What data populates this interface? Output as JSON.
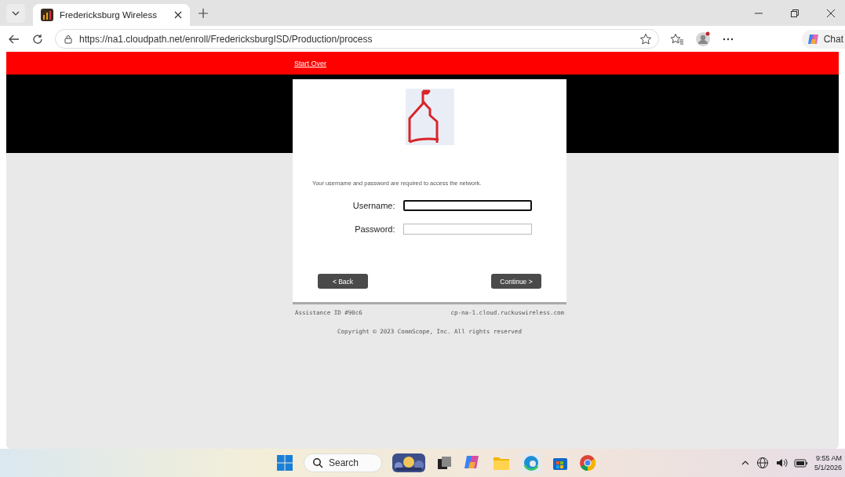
{
  "browser": {
    "tab_title": "Fredericksburg Wireless",
    "url": "https://na1.cloudpath.net/enroll/FredericksburgISD/Production/process",
    "copilot_label": "Chat"
  },
  "page": {
    "start_over": "Start Over",
    "message": "Your username and password are required to access the network.",
    "fields": [
      {
        "label": "Username:",
        "focused": true
      },
      {
        "label": "Password:",
        "focused": false
      }
    ],
    "buttons": [
      "< Back",
      "Continue >"
    ],
    "assistance_id": "Assistance ID #90c6",
    "server": "cp-na-1.cloud.ruckuswireless.com",
    "copyright": "Copyright © 2023 CommScope, Inc. All rights reserved"
  },
  "taskbar": {
    "search_label": "Search",
    "time": "9:55 AM",
    "date": "5/1/2026"
  }
}
